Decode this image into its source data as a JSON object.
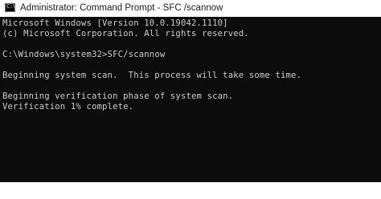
{
  "window": {
    "title": "Administrator: Command Prompt - SFC /scannow",
    "icon": "command-prompt-icon",
    "icon_glyph": "C:\\",
    "colors": {
      "console_background": "#0c0c0c",
      "console_text": "#cccccc",
      "titlebar_background": "#ffffff"
    }
  },
  "console": {
    "lines": [
      "Microsoft Windows [Version 10.0.19042.1110]",
      "(c) Microsoft Corporation. All rights reserved.",
      "",
      "C:\\Windows\\system32>SFC/scannow",
      "",
      "Beginning system scan.  This process will take some time.",
      "",
      "Beginning verification phase of system scan.",
      "Verification 1% complete."
    ]
  }
}
